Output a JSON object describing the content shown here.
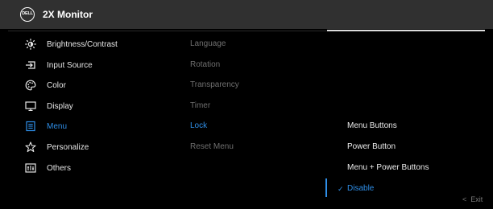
{
  "header": {
    "logo_text": "DELL",
    "title": "2X Monitor"
  },
  "menu": [
    {
      "label": "Brightness/Contrast",
      "icon": "brightness-icon"
    },
    {
      "label": "Input Source",
      "icon": "input-source-icon"
    },
    {
      "label": "Color",
      "icon": "color-palette-icon"
    },
    {
      "label": "Display",
      "icon": "display-icon"
    },
    {
      "label": "Menu",
      "icon": "menu-icon"
    },
    {
      "label": "Personalize",
      "icon": "star-icon"
    },
    {
      "label": "Others",
      "icon": "others-icon"
    }
  ],
  "submenu": [
    {
      "label": "Language"
    },
    {
      "label": "Rotation"
    },
    {
      "label": "Transparency"
    },
    {
      "label": "Timer"
    },
    {
      "label": "Lock"
    },
    {
      "label": "Reset Menu"
    }
  ],
  "options": [
    {
      "label": "Menu Buttons"
    },
    {
      "label": "Power Button"
    },
    {
      "label": "Menu + Power Buttons"
    },
    {
      "label": "Disable"
    }
  ],
  "exit": {
    "arrow": "<",
    "label": "Exit"
  },
  "colors": {
    "accent": "#2f8fe8",
    "header_bg": "#303030",
    "background": "#000000"
  }
}
